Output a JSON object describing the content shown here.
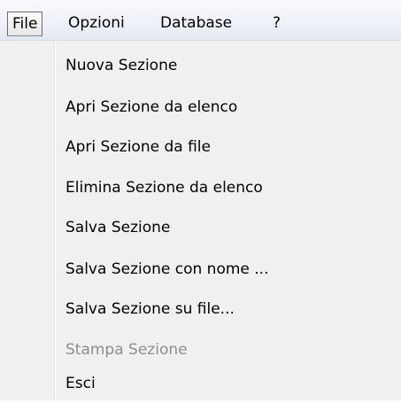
{
  "menubar": {
    "items": [
      {
        "label": "File",
        "active": true
      },
      {
        "label": "Opzioni"
      },
      {
        "label": "Database"
      },
      {
        "label": "?"
      }
    ]
  },
  "file_menu": {
    "items": [
      {
        "label": "Nuova Sezione",
        "enabled": true
      },
      {
        "label": "Apri Sezione da elenco",
        "enabled": true
      },
      {
        "label": "Apri Sezione da file",
        "enabled": true
      },
      {
        "label": "Elimina Sezione da elenco",
        "enabled": true
      },
      {
        "label": "Salva Sezione",
        "enabled": true
      },
      {
        "label": "Salva Sezione con nome ...",
        "enabled": true
      },
      {
        "label": "Salva Sezione su file...",
        "enabled": true
      },
      {
        "label": "Stampa Sezione",
        "enabled": false
      },
      {
        "label": "Esci",
        "enabled": true
      }
    ]
  }
}
